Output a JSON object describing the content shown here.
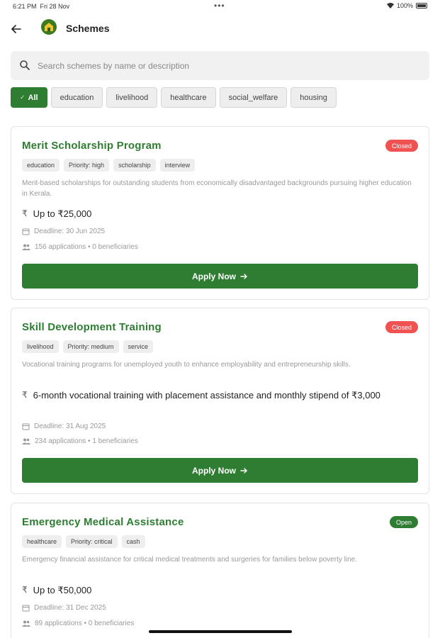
{
  "status_bar": {
    "time": "6:21 PM",
    "date": "Fri 28 Nov",
    "battery": "100%"
  },
  "header": {
    "title": "Schemes"
  },
  "search": {
    "placeholder": "Search schemes by name or description"
  },
  "filters": [
    "All",
    "education",
    "livelihood",
    "healthcare",
    "social_welfare",
    "housing"
  ],
  "active_filter": "All",
  "apply_label": "Apply Now",
  "colors": {
    "primary": "#2e7d32",
    "closed": "#f05252",
    "chip_bg": "#eeeeee"
  },
  "schemes": [
    {
      "title": "Merit Scholarship Program",
      "status": "Closed",
      "tags": [
        "education",
        "Priority: high",
        "scholarship",
        "interview"
      ],
      "description": "Merit-based scholarships for outstanding students from economically disadvantaged backgrounds pursuing higher education in Kerala.",
      "benefit": "Up to ₹25,000",
      "deadline": "Deadline: 30 Jun 2025",
      "stats": "156 applications • 0 beneficiaries"
    },
    {
      "title": "Skill Development Training",
      "status": "Closed",
      "tags": [
        "livelihood",
        "Priority: medium",
        "service"
      ],
      "description": "Vocational training programs for unemployed youth to enhance employability and entrepreneurship skills.",
      "benefit": "6-month vocational training with placement assistance and monthly stipend of ₹3,000",
      "deadline": "Deadline: 31 Aug 2025",
      "stats": "234 applications • 1 beneficiaries"
    },
    {
      "title": "Emergency Medical Assistance",
      "status": "Open",
      "tags": [
        "healthcare",
        "Priority: critical",
        "cash"
      ],
      "description": "Emergency financial assistance for critical medical treatments and surgeries for families below poverty line.",
      "benefit": "Up to ₹50,000",
      "deadline": "Deadline: 31 Dec 2025",
      "stats": "89 applications • 0 beneficiaries"
    }
  ]
}
